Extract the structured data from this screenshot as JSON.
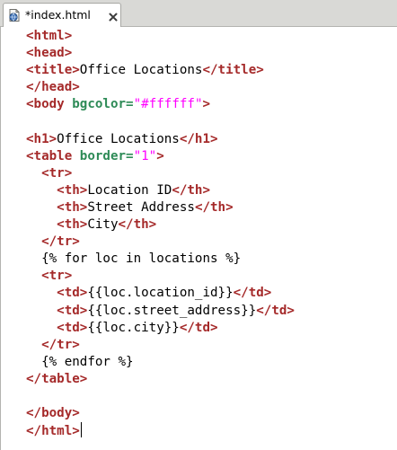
{
  "tab": {
    "label": "*index.html",
    "icon": "html-file-icon",
    "close_icon": "close-icon"
  },
  "editor": {
    "lines": [
      {
        "indent": "",
        "tokens": [
          {
            "t": "tag",
            "v": "<html>"
          }
        ]
      },
      {
        "indent": "",
        "tokens": [
          {
            "t": "tag",
            "v": "<head>"
          }
        ]
      },
      {
        "indent": "",
        "tokens": [
          {
            "t": "tag",
            "v": "<title>"
          },
          {
            "t": "txt",
            "v": "Office Locations"
          },
          {
            "t": "tag",
            "v": "</title>"
          }
        ]
      },
      {
        "indent": "",
        "tokens": [
          {
            "t": "tag",
            "v": "</head>"
          }
        ]
      },
      {
        "indent": "",
        "tokens": [
          {
            "t": "tag",
            "v": "<body"
          },
          {
            "t": "txt",
            "v": " "
          },
          {
            "t": "attr",
            "v": "bgcolor="
          },
          {
            "t": "str",
            "v": "\"#ffffff\""
          },
          {
            "t": "tag",
            "v": ">"
          }
        ]
      },
      {
        "indent": "",
        "tokens": []
      },
      {
        "indent": "",
        "tokens": [
          {
            "t": "tag",
            "v": "<h1>"
          },
          {
            "t": "txt",
            "v": "Office Locations"
          },
          {
            "t": "tag",
            "v": "</h1>"
          }
        ]
      },
      {
        "indent": "",
        "tokens": [
          {
            "t": "tag",
            "v": "<table"
          },
          {
            "t": "txt",
            "v": " "
          },
          {
            "t": "attr",
            "v": "border="
          },
          {
            "t": "str",
            "v": "\"1\""
          },
          {
            "t": "tag",
            "v": ">"
          }
        ]
      },
      {
        "indent": "  ",
        "tokens": [
          {
            "t": "tag",
            "v": "<tr>"
          }
        ]
      },
      {
        "indent": "    ",
        "tokens": [
          {
            "t": "tag",
            "v": "<th>"
          },
          {
            "t": "txt",
            "v": "Location ID"
          },
          {
            "t": "tag",
            "v": "</th>"
          }
        ]
      },
      {
        "indent": "    ",
        "tokens": [
          {
            "t": "tag",
            "v": "<th>"
          },
          {
            "t": "txt",
            "v": "Street Address"
          },
          {
            "t": "tag",
            "v": "</th>"
          }
        ]
      },
      {
        "indent": "    ",
        "tokens": [
          {
            "t": "tag",
            "v": "<th>"
          },
          {
            "t": "txt",
            "v": "City"
          },
          {
            "t": "tag",
            "v": "</th>"
          }
        ]
      },
      {
        "indent": "  ",
        "tokens": [
          {
            "t": "tag",
            "v": "</tr>"
          }
        ]
      },
      {
        "indent": "  ",
        "tokens": [
          {
            "t": "txt",
            "v": "{% for loc in locations %}"
          }
        ]
      },
      {
        "indent": "  ",
        "tokens": [
          {
            "t": "tag",
            "v": "<tr>"
          }
        ]
      },
      {
        "indent": "    ",
        "tokens": [
          {
            "t": "tag",
            "v": "<td>"
          },
          {
            "t": "txt",
            "v": "{{loc.location_id}}"
          },
          {
            "t": "tag",
            "v": "</td>"
          }
        ]
      },
      {
        "indent": "    ",
        "tokens": [
          {
            "t": "tag",
            "v": "<td>"
          },
          {
            "t": "txt",
            "v": "{{loc.street_address}}"
          },
          {
            "t": "tag",
            "v": "</td>"
          }
        ]
      },
      {
        "indent": "    ",
        "tokens": [
          {
            "t": "tag",
            "v": "<td>"
          },
          {
            "t": "txt",
            "v": "{{loc.city}}"
          },
          {
            "t": "tag",
            "v": "</td>"
          }
        ]
      },
      {
        "indent": "  ",
        "tokens": [
          {
            "t": "tag",
            "v": "</tr>"
          }
        ]
      },
      {
        "indent": "  ",
        "tokens": [
          {
            "t": "txt",
            "v": "{% endfor %}"
          }
        ]
      },
      {
        "indent": "",
        "tokens": [
          {
            "t": "tag",
            "v": "</table>"
          }
        ]
      },
      {
        "indent": "",
        "tokens": []
      },
      {
        "indent": "",
        "tokens": [
          {
            "t": "tag",
            "v": "</body>"
          }
        ]
      },
      {
        "indent": "",
        "tokens": [
          {
            "t": "tag",
            "v": "</html>"
          }
        ],
        "cursor": true
      }
    ]
  },
  "colors": {
    "tag": "#a52a2a",
    "attribute": "#2e8b57",
    "string": "#ff00ff",
    "text": "#000000",
    "tab_strip": "#d9d9d6",
    "background": "#ffffff"
  }
}
